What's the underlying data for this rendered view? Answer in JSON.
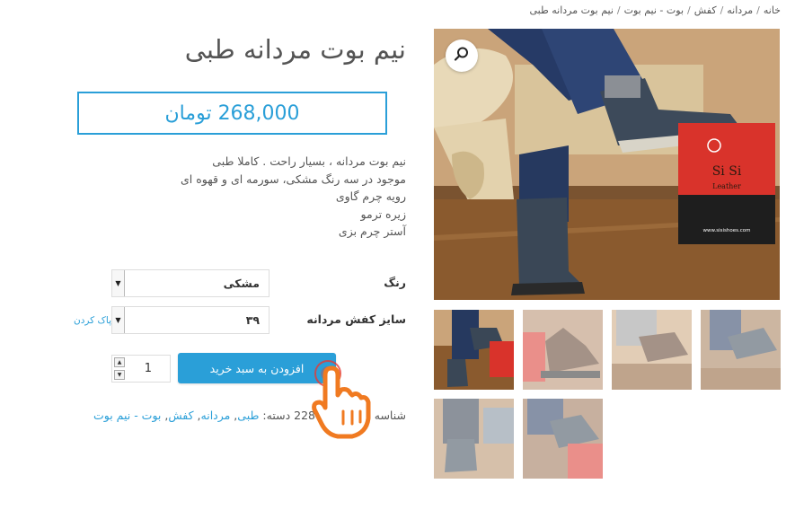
{
  "breadcrumb": [
    {
      "label": "خانه"
    },
    {
      "label": "مردانه"
    },
    {
      "label": "کفش"
    },
    {
      "label": "بوت - نیم بوت"
    },
    {
      "label": "نیم بوت مردانه طبی"
    }
  ],
  "product": {
    "title": "نیم بوت مردانه طبی",
    "price": "268,000 تومان",
    "description": [
      "نیم بوت مردانه ، بسیار راحت . کاملا طبی",
      "موجود در سه رنگ مشکی، سورمه ای و قهوه ای",
      "رویه چرم گاوی",
      "زیره ترمو",
      "آستر چرم بزی"
    ]
  },
  "attributes": {
    "color_label": "رنگ",
    "color_value": "مشکی",
    "size_label": "سایز کفش مردانه",
    "size_value": "۳۹",
    "reset_label": "پاک کردن"
  },
  "cart": {
    "quantity": "1",
    "add_button_label": "افزودن به سبد خرید"
  },
  "meta": {
    "sku_text": "شناسه محصول: 1-228",
    "category_label": "دسته:",
    "categories": [
      "طبی",
      "مردانه",
      "کفش",
      "بوت - نیم بوت"
    ]
  },
  "gallery": {
    "box_brand": "Si Si",
    "box_sub": "Leather",
    "box_url": "www.sisishoes.com",
    "thumbnail_count": 6
  },
  "colors": {
    "accent": "#2a9fd8",
    "text": "#555555",
    "pointer": "#f07a21"
  },
  "icons": {
    "zoom": "search-icon",
    "cursor": "hand-pointer-icon"
  }
}
